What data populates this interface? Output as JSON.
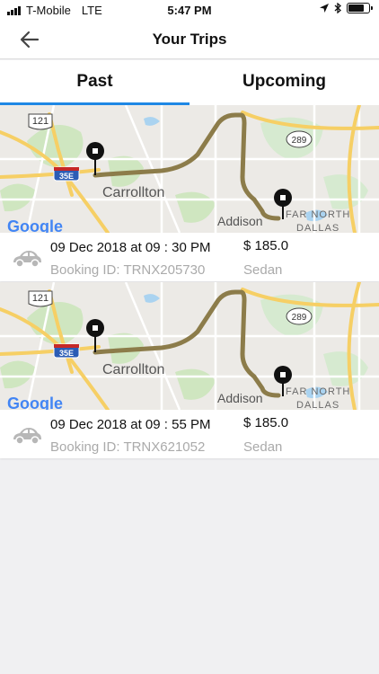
{
  "status_bar": {
    "carrier": "T-Mobile",
    "network": "LTE",
    "time": "5:47 PM",
    "battery_level": 0.75
  },
  "nav": {
    "title": "Your Trips",
    "back_icon": "arrow-left-icon"
  },
  "tabs": [
    {
      "label": "Past",
      "active": true
    },
    {
      "label": "Upcoming",
      "active": false
    }
  ],
  "map_labels": {
    "carrollton": "Carrollton",
    "addison": "Addison",
    "far_north": "FAR NORTH",
    "dallas": "DALLAS",
    "google": "Google",
    "hwy_121": "121",
    "hwy_35e": "35E",
    "hwy_289": "289"
  },
  "trips": [
    {
      "datetime": "09 Dec 2018 at 09 : 30 PM",
      "booking_id": "Booking ID: TRNX205730",
      "price": "$ 185.0",
      "vehicle": "Sedan"
    },
    {
      "datetime": "09 Dec 2018 at 09 : 55 PM",
      "booking_id": "Booking ID: TRNX621052",
      "price": "$ 185.0",
      "vehicle": "Sedan"
    }
  ],
  "colors": {
    "accent": "#1e88e5",
    "route": "#8c7c4a",
    "highway": "#f6cf65",
    "map_bg": "#eceae6",
    "park": "#cfe6c0"
  }
}
